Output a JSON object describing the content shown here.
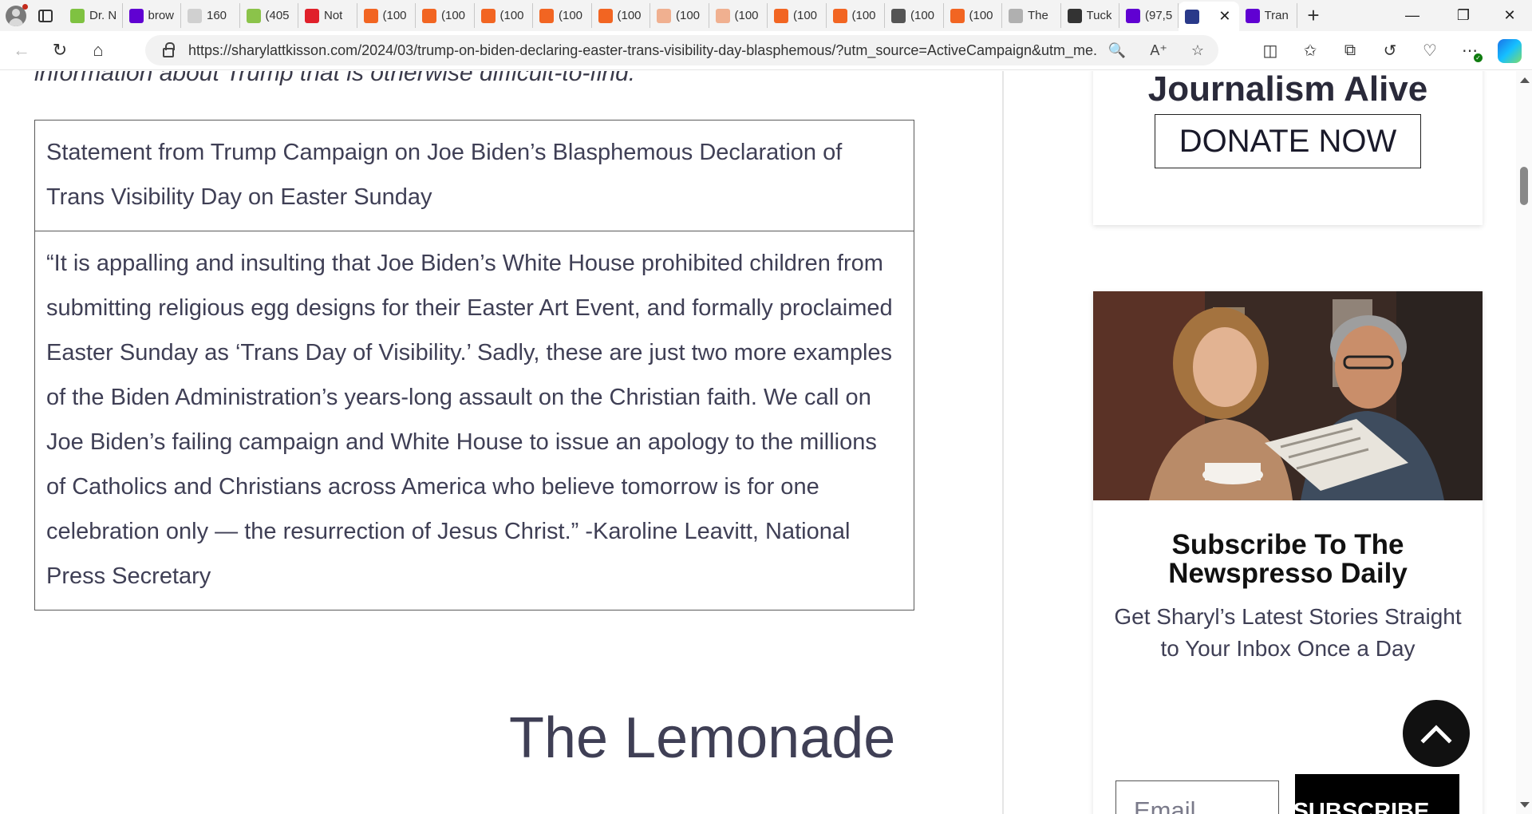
{
  "browser": {
    "tabs": [
      {
        "title": "Dr. N",
        "icon": "play-icon",
        "color": "#7fc241"
      },
      {
        "title": "brow",
        "icon": "yahoo-icon",
        "color": "#6001d2"
      },
      {
        "title": "160",
        "icon": "bi-icon",
        "color": "#d0d0d0"
      },
      {
        "title": "(405",
        "icon": "g-icon",
        "color": "#8bc34a"
      },
      {
        "title": "Not",
        "icon": "alert-icon",
        "color": "#e0202a"
      },
      {
        "title": "(100",
        "icon": "bookmark-icon",
        "color": "#f26522"
      },
      {
        "title": "(100",
        "icon": "bookmark-icon",
        "color": "#f26522"
      },
      {
        "title": "(100",
        "icon": "bookmark-icon",
        "color": "#f26522"
      },
      {
        "title": "(100",
        "icon": "bookmark-icon",
        "color": "#f26522"
      },
      {
        "title": "(100",
        "icon": "bookmark-icon",
        "color": "#f26522"
      },
      {
        "title": "(100",
        "icon": "bookmark-icon",
        "color": "#f0b090"
      },
      {
        "title": "(100",
        "icon": "bookmark-icon",
        "color": "#f0b090"
      },
      {
        "title": "(100",
        "icon": "bookmark-icon",
        "color": "#f26522"
      },
      {
        "title": "(100",
        "icon": "bookmark-icon",
        "color": "#f26522"
      },
      {
        "title": "(100",
        "icon": "image-icon",
        "color": "#555555"
      },
      {
        "title": "(100",
        "icon": "bookmark-icon",
        "color": "#f26522"
      },
      {
        "title": "The",
        "icon": "cs-icon",
        "color": "#b0b0b0"
      },
      {
        "title": "Tuck",
        "icon": "x-icon",
        "color": "#333333"
      },
      {
        "title": "(97,5",
        "icon": "mail-icon",
        "color": "#6001d2"
      },
      {
        "title": "",
        "icon": "site-icon",
        "color": "#2a3a8a",
        "active": true
      },
      {
        "title": "Tran",
        "icon": "yahoo-icon",
        "color": "#6001d2"
      }
    ],
    "url": "https://sharylattkisson.com/2024/03/trump-on-biden-declaring-easter-trans-visibility-day-blasphemous/?utm_source=ActiveCampaign&utm_me..."
  },
  "article": {
    "intro": "information about Trump that is otherwise difficult-to-find.",
    "table": {
      "heading": "Statement from Trump Campaign on Joe Biden’s Blasphemous Declaration of Trans Visibility Day on Easter Sunday",
      "quote": "“It is appalling and insulting that Joe Biden’s White House prohibited children from submitting religious egg designs for their Easter Art Event, and formally proclaimed Easter Sunday as ‘Trans Day of Visibility.’ Sadly, these are just two more examples of the Biden Administration’s years-long assault on the Christian faith. We call on Joe Biden’s failing campaign and White House to issue an apology to the millions of Catholics and Christians across America who believe tomorrow is for one celebration only — the resurrection of Jesus Christ.” -Karoline Leavitt, National Press Secretary"
    },
    "next_heading": "The Lemonade"
  },
  "sidebar": {
    "donate_title": "Journalism Alive",
    "donate_button": "DONATE NOW",
    "subscribe": {
      "title": "Subscribe To The Newspresso Daily",
      "description": "Get Sharyl’s Latest Stories Straight to Your Inbox Once a Day",
      "email_placeholder": "Email",
      "button": "SUBSCRIBE"
    }
  }
}
